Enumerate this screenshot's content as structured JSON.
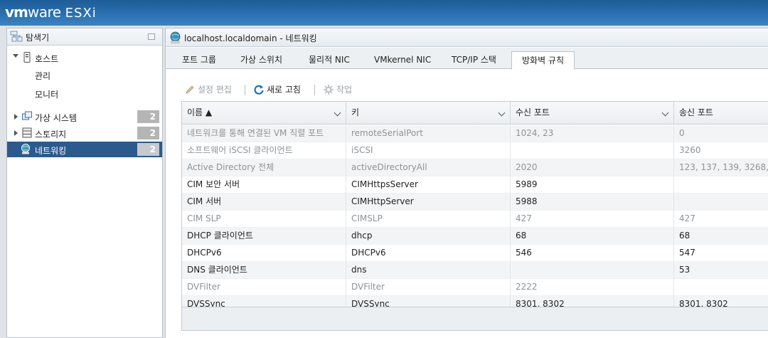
{
  "brand": {
    "vm": "vm",
    "ware": "ware",
    "product": "ESXi"
  },
  "navigator": {
    "title": "탐색기",
    "icon": "navigator-icon",
    "host": {
      "label": "호스트",
      "children": [
        "관리",
        "모니터"
      ]
    },
    "items": [
      {
        "label": "가상 시스템",
        "count": "2",
        "icon": "vm-icon"
      },
      {
        "label": "스토리지",
        "count": "2",
        "icon": "storage-icon"
      },
      {
        "label": "네트워킹",
        "count": "2",
        "icon": "network-icon",
        "selected": true
      }
    ]
  },
  "main": {
    "title": "localhost.localdomain - 네트워킹",
    "tabs": [
      {
        "label": "포트 그룹"
      },
      {
        "label": "가상 스위치"
      },
      {
        "label": "물리적 NIC"
      },
      {
        "label": "VMkernel NIC"
      },
      {
        "label": "TCP/IP 스택"
      },
      {
        "label": "방화벽 규칙",
        "active": true
      }
    ],
    "toolbar": {
      "edit_label": "설정 편집",
      "refresh_label": "새로 고침",
      "actions_label": "작업"
    }
  },
  "grid": {
    "columns": [
      "이름 ▲",
      "키",
      "수신 포트",
      "송신 포트"
    ],
    "rows": [
      {
        "name": "네트워크를 통해 연결된 VM 직렬 포트",
        "key": "remoteSerialPort",
        "in": "1024, 23",
        "out": "0",
        "dim": true
      },
      {
        "name": "소프트웨어 iSCSI 클라이언트",
        "key": "iSCSI",
        "in": "",
        "out": "3260",
        "dim": true
      },
      {
        "name": "Active Directory 전체",
        "key": "activeDirectoryAll",
        "in": "2020",
        "out": "123, 137, 139, 3268, 38",
        "dim": true
      },
      {
        "name": "CIM 보안 서버",
        "key": "CIMHttpsServer",
        "in": "5989",
        "out": "",
        "dim": false
      },
      {
        "name": "CIM 서버",
        "key": "CIMHttpServer",
        "in": "5988",
        "out": "",
        "dim": false
      },
      {
        "name": "CIM SLP",
        "key": "CIMSLP",
        "in": "427",
        "out": "427",
        "dim": true
      },
      {
        "name": "DHCP 클라이언트",
        "key": "dhcp",
        "in": "68",
        "out": "68",
        "dim": false
      },
      {
        "name": "DHCPv6",
        "key": "DHCPv6",
        "in": "546",
        "out": "547",
        "dim": false
      },
      {
        "name": "DNS 클라이언트",
        "key": "dns",
        "in": "",
        "out": "53",
        "dim": false
      },
      {
        "name": "DVFilter",
        "key": "DVFilter",
        "in": "2222",
        "out": "",
        "dim": true
      },
      {
        "name": "DVSSync",
        "key": "DVSSync",
        "in": "8301, 8302",
        "out": "8301, 8302",
        "dim": false
      }
    ]
  },
  "colors": {
    "banner": "#2a70b0",
    "selected": "#2c5a8d",
    "refresh_icon": "#1f6fc0"
  }
}
